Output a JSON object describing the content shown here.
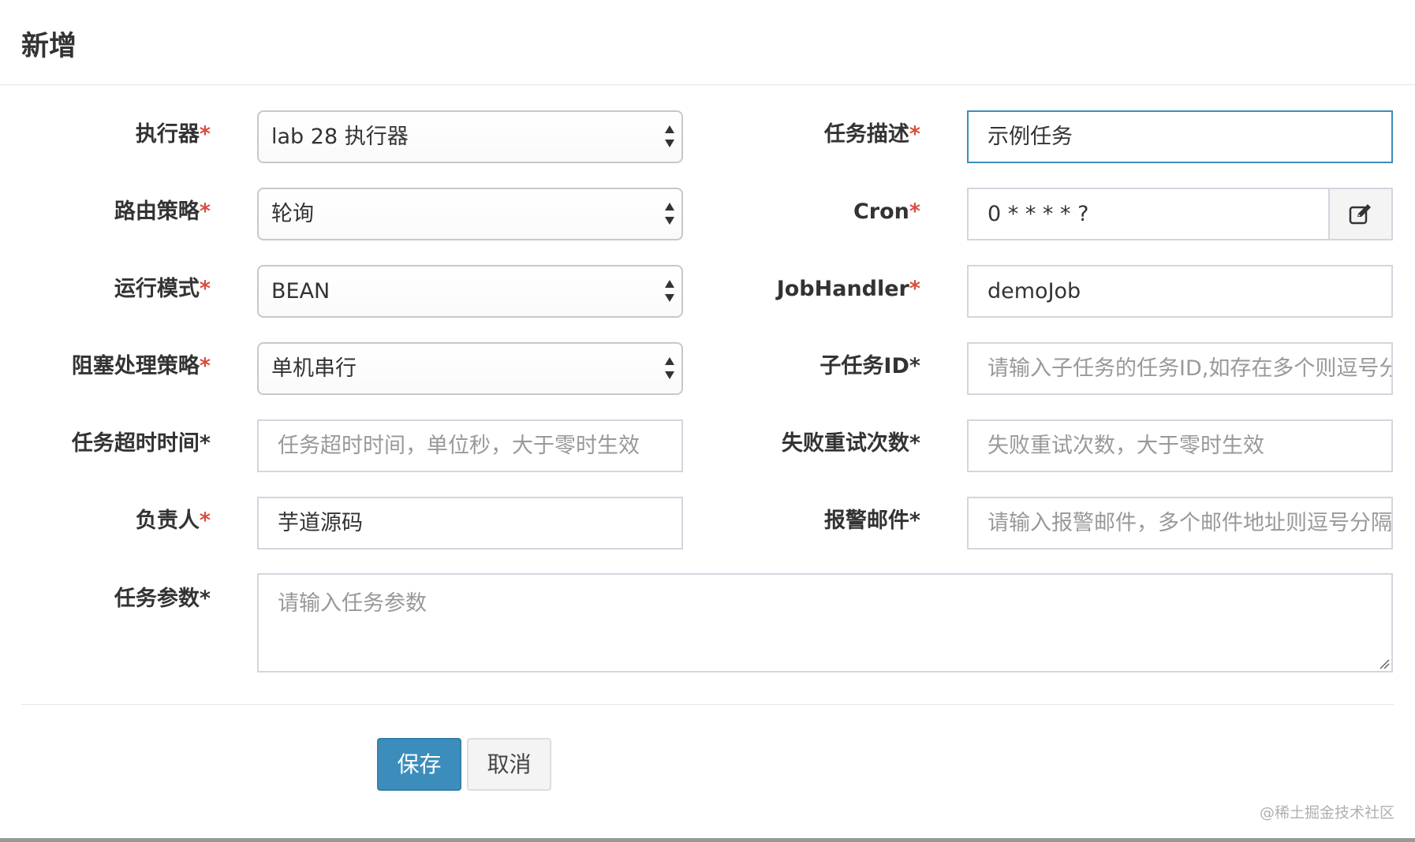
{
  "modal": {
    "title": "新增"
  },
  "fields": {
    "executor": {
      "label": "执行器",
      "required_mark": "*",
      "value": "lab 28 执行器"
    },
    "route_strategy": {
      "label": "路由策略",
      "required_mark": "*",
      "value": "轮询"
    },
    "run_mode": {
      "label": "运行模式",
      "required_mark": "*",
      "value": "BEAN"
    },
    "block_strategy": {
      "label": "阻塞处理策略",
      "required_mark": "*",
      "value": "单机串行"
    },
    "timeout": {
      "label": "任务超时时间",
      "required_mark": "*",
      "placeholder": "任务超时时间，单位秒，大于零时生效"
    },
    "author": {
      "label": "负责人",
      "required_mark": "*",
      "value": "芋道源码"
    },
    "params": {
      "label": "任务参数",
      "required_mark": "*",
      "placeholder": "请输入任务参数"
    },
    "job_desc": {
      "label": "任务描述",
      "required_mark": "*",
      "value": "示例任务"
    },
    "cron": {
      "label": "Cron",
      "required_mark": "*",
      "value": "0 * * * * ?",
      "addon_icon": "edit-icon"
    },
    "job_handler": {
      "label": "JobHandler",
      "required_mark": "*",
      "value": "demoJob"
    },
    "child_job_id": {
      "label": "子任务ID",
      "required_mark": "*",
      "placeholder": "请输入子任务的任务ID,如存在多个则逗号分隔"
    },
    "retry_count": {
      "label": "失败重试次数",
      "required_mark": "*",
      "placeholder": "失败重试次数，大于零时生效"
    },
    "alarm_email": {
      "label": "报警邮件",
      "required_mark": "*",
      "placeholder": "请输入报警邮件，多个邮件地址则逗号分隔"
    }
  },
  "buttons": {
    "save": "保存",
    "cancel": "取消"
  },
  "watermark": "@稀土掘金技术社区",
  "colors": {
    "primary": "#3c8dbc",
    "required": "#dd4b39",
    "focus_border": "#3c8dbc"
  }
}
